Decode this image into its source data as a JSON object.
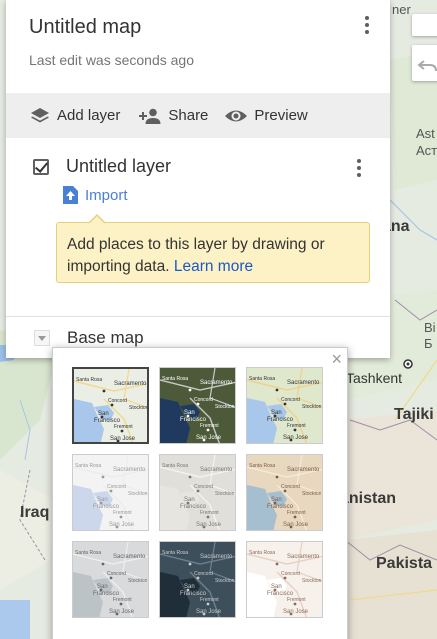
{
  "map": {
    "labels": {
      "iraq": "Iraq",
      "tashkent": "Tashkent",
      "tajik": "Tajiki",
      "afghanistan": "anistan",
      "pakistan": "Pakista",
      "astana1": "Ast",
      "astana2": "Аст",
      "astana3": "ana",
      "almaty1": "Bi",
      "almaty2": "Б",
      "top_edge": "ner"
    }
  },
  "panel": {
    "title": "Untitled map",
    "subtitle": "Last edit was seconds ago",
    "toolbar": {
      "add_layer": "Add layer",
      "share": "Share",
      "preview": "Preview"
    },
    "layer": {
      "name": "Untitled layer",
      "import": "Import",
      "tooltip_text": "Add places to this layer by drawing or importing data.",
      "tooltip_link": "Learn more"
    },
    "basemap": {
      "label": "Base map"
    }
  },
  "popup": {
    "close": "×",
    "tiles": [
      {
        "style": "map",
        "selected": true
      },
      {
        "style": "satellite",
        "selected": false
      },
      {
        "style": "terrain",
        "selected": false
      },
      {
        "style": "light-political",
        "selected": false
      },
      {
        "style": "mono-city",
        "selected": false
      },
      {
        "style": "simple-atlas",
        "selected": false
      },
      {
        "style": "light-landmass",
        "selected": false
      },
      {
        "style": "dark-landmass",
        "selected": false
      },
      {
        "style": "whitewater",
        "selected": false
      }
    ],
    "tile_labels": {
      "santa_rosa": "Santa Rosa",
      "sacramento": "Sacramento",
      "concord": "Concord",
      "san": "San",
      "francisco": "Francisco",
      "fremont": "Fremont",
      "san_jose": "San Jose",
      "stockton": "Stockton"
    }
  },
  "colors": {
    "link": "#1a58c5",
    "import": "#4a7fd6",
    "tooltip_bg": "#fdf2c6"
  }
}
